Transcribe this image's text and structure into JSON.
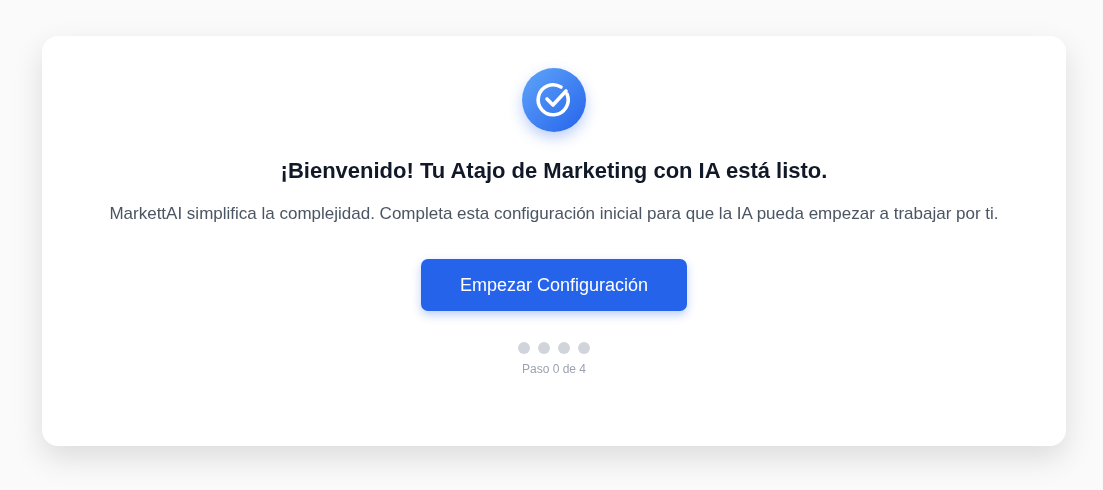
{
  "card": {
    "title": "¡Bienvenido! Tu Atajo de Marketing con IA está listo.",
    "description": "MarkettAI simplifica la complejidad. Completa esta configuración inicial para que la IA pueda empezar a trabajar por ti.",
    "button": "Empezar Configuración",
    "steps": [
      {
        "active": false
      },
      {
        "active": false
      },
      {
        "active": false
      },
      {
        "active": false
      }
    ],
    "step_label": "Paso 0 de 4"
  }
}
